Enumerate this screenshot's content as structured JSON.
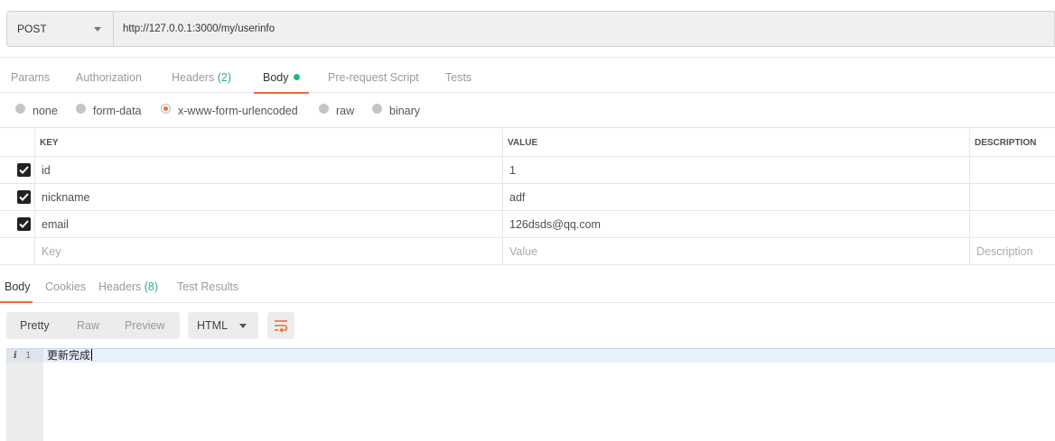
{
  "request": {
    "method": "POST",
    "url": "http://127.0.0.1:3000/my/userinfo"
  },
  "request_tabs": [
    {
      "label": "Params"
    },
    {
      "label": "Authorization"
    },
    {
      "label": "Headers",
      "count": "(2)"
    },
    {
      "label": "Body",
      "active": true,
      "dot": true
    },
    {
      "label": "Pre-request Script"
    },
    {
      "label": "Tests"
    }
  ],
  "body_types": [
    {
      "label": "none",
      "checked": false
    },
    {
      "label": "form-data",
      "checked": false
    },
    {
      "label": "x-www-form-urlencoded",
      "checked": true
    },
    {
      "label": "raw",
      "checked": false
    },
    {
      "label": "binary",
      "checked": false
    }
  ],
  "params_table": {
    "headers": {
      "key": "KEY",
      "value": "VALUE",
      "description": "DESCRIPTION"
    },
    "rows": [
      {
        "checked": true,
        "key": "id",
        "value": "1",
        "description": ""
      },
      {
        "checked": true,
        "key": "nickname",
        "value": "adf",
        "description": ""
      },
      {
        "checked": true,
        "key": "email",
        "value": "126dsds@qq.com",
        "description": ""
      }
    ],
    "placeholder": {
      "key": "Key",
      "value": "Value",
      "description": "Description"
    }
  },
  "response_tabs": [
    {
      "label": "Body",
      "active": true
    },
    {
      "label": "Cookies"
    },
    {
      "label": "Headers",
      "count": "(8)"
    },
    {
      "label": "Test Results"
    }
  ],
  "response_view": {
    "modes": [
      "Pretty",
      "Raw",
      "Preview"
    ],
    "active_mode": "Pretty",
    "format": "HTML",
    "wrap_icon": "wrap-lines-icon"
  },
  "response_body": {
    "line_number": "1",
    "info_marker": "i",
    "text": "更新完成"
  },
  "colors": {
    "accent": "#f26b3a",
    "count_green": "#26b47f"
  }
}
